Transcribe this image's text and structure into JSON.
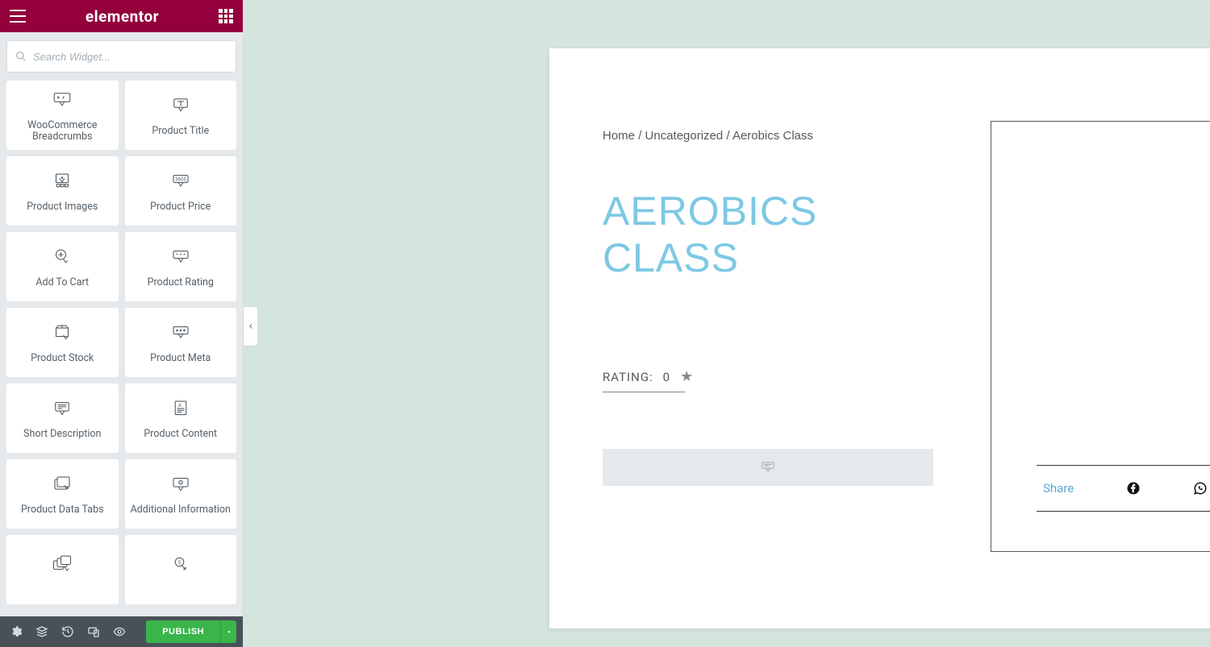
{
  "brand": "elementor",
  "search": {
    "placeholder": "Search Widget..."
  },
  "widgets": [
    {
      "label": "WooCommerce Breadcrumbs",
      "icon": "breadcrumbs"
    },
    {
      "label": "Product Title",
      "icon": "title"
    },
    {
      "label": "Product Images",
      "icon": "images"
    },
    {
      "label": "Product Price",
      "icon": "price"
    },
    {
      "label": "Add To Cart",
      "icon": "addcart"
    },
    {
      "label": "Product Rating",
      "icon": "rating"
    },
    {
      "label": "Product Stock",
      "icon": "stock"
    },
    {
      "label": "Product Meta",
      "icon": "meta"
    },
    {
      "label": "Short Description",
      "icon": "shortdesc"
    },
    {
      "label": "Product Content",
      "icon": "content"
    },
    {
      "label": "Product Data Tabs",
      "icon": "datatabs"
    },
    {
      "label": "Additional Information",
      "icon": "addinfo"
    },
    {
      "label": "",
      "icon": "related"
    },
    {
      "label": "",
      "icon": "upsell"
    }
  ],
  "footer": {
    "publish": "Publish"
  },
  "page": {
    "breadcrumb": {
      "home": "Home",
      "category": "Uncategorized",
      "current": "Aerobics Class"
    },
    "title": "AEROBICS CLASS",
    "rating": {
      "label": "RATING:",
      "value": "0"
    },
    "share": {
      "label": "Share"
    }
  }
}
